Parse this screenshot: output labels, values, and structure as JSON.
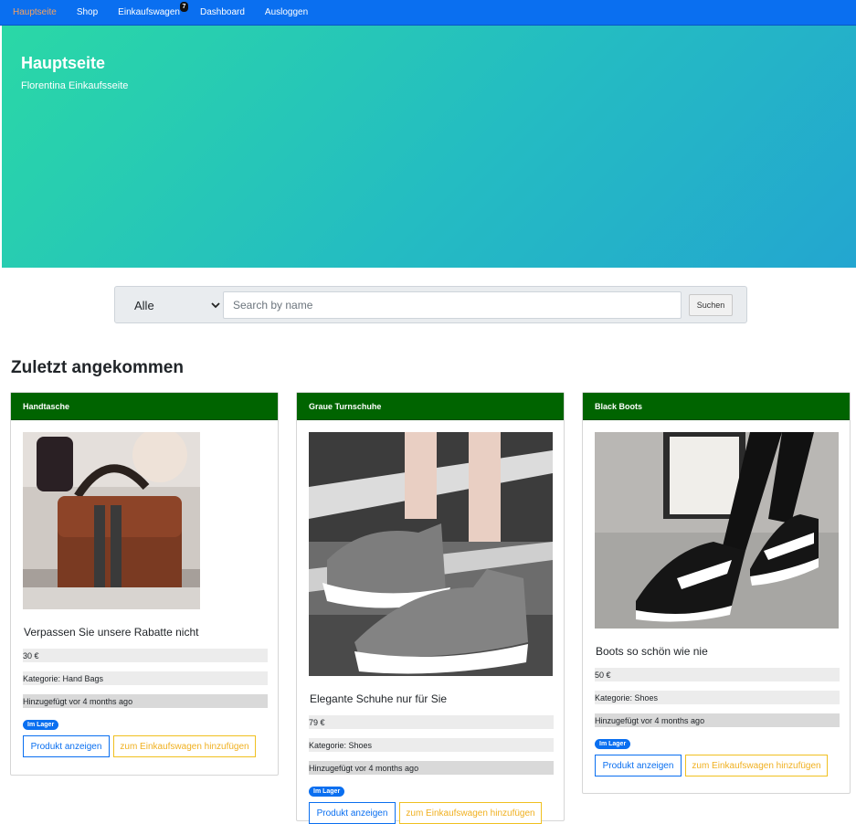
{
  "nav": {
    "items": [
      {
        "label": "Hauptseite",
        "active": true
      },
      {
        "label": "Shop"
      },
      {
        "label": "Einkaufswagen"
      },
      {
        "label": "Dashboard"
      },
      {
        "label": "Ausloggen"
      }
    ],
    "cart_count": "7"
  },
  "hero": {
    "title": "Hauptseite",
    "subtitle": "Florentina Einkaufsseite"
  },
  "search": {
    "category": "Alle",
    "placeholder": "Search by name",
    "button": "Suchen"
  },
  "section_title": "Zuletzt angekommen",
  "products": [
    {
      "name": "Handtasche",
      "description": "Verpassen Sie unsere Rabatte nicht",
      "price": "30 €",
      "category": "Kategorie: Hand Bags",
      "added": "Hinzugefügt vor 4 months ago",
      "stock": "Im Lager",
      "view_label": "Produkt anzeigen",
      "cart_label": "zum Einkaufswagen hinzufügen"
    },
    {
      "name": "Graue Turnschuhe",
      "description": "Elegante Schuhe nur für Sie",
      "price": "79 €",
      "category": "Kategorie: Shoes",
      "added": "Hinzugefügt vor 4 months ago",
      "stock": "Im Lager",
      "view_label": "Produkt anzeigen",
      "cart_label": "zum Einkaufswagen hinzufügen"
    },
    {
      "name": "Black Boots",
      "description": "Boots so schön wie nie",
      "price": "50 €",
      "category": "Kategorie: Shoes",
      "added": "Hinzugefügt vor 4 months ago",
      "stock": "Im Lager",
      "view_label": "Produkt anzeigen",
      "cart_label": "zum Einkaufswagen hinzufügen"
    }
  ],
  "colors": {
    "nav": "#0a6ff0",
    "card_header": "#006400",
    "accent_yellow": "#f0b020",
    "active_nav": "#f4a261"
  }
}
